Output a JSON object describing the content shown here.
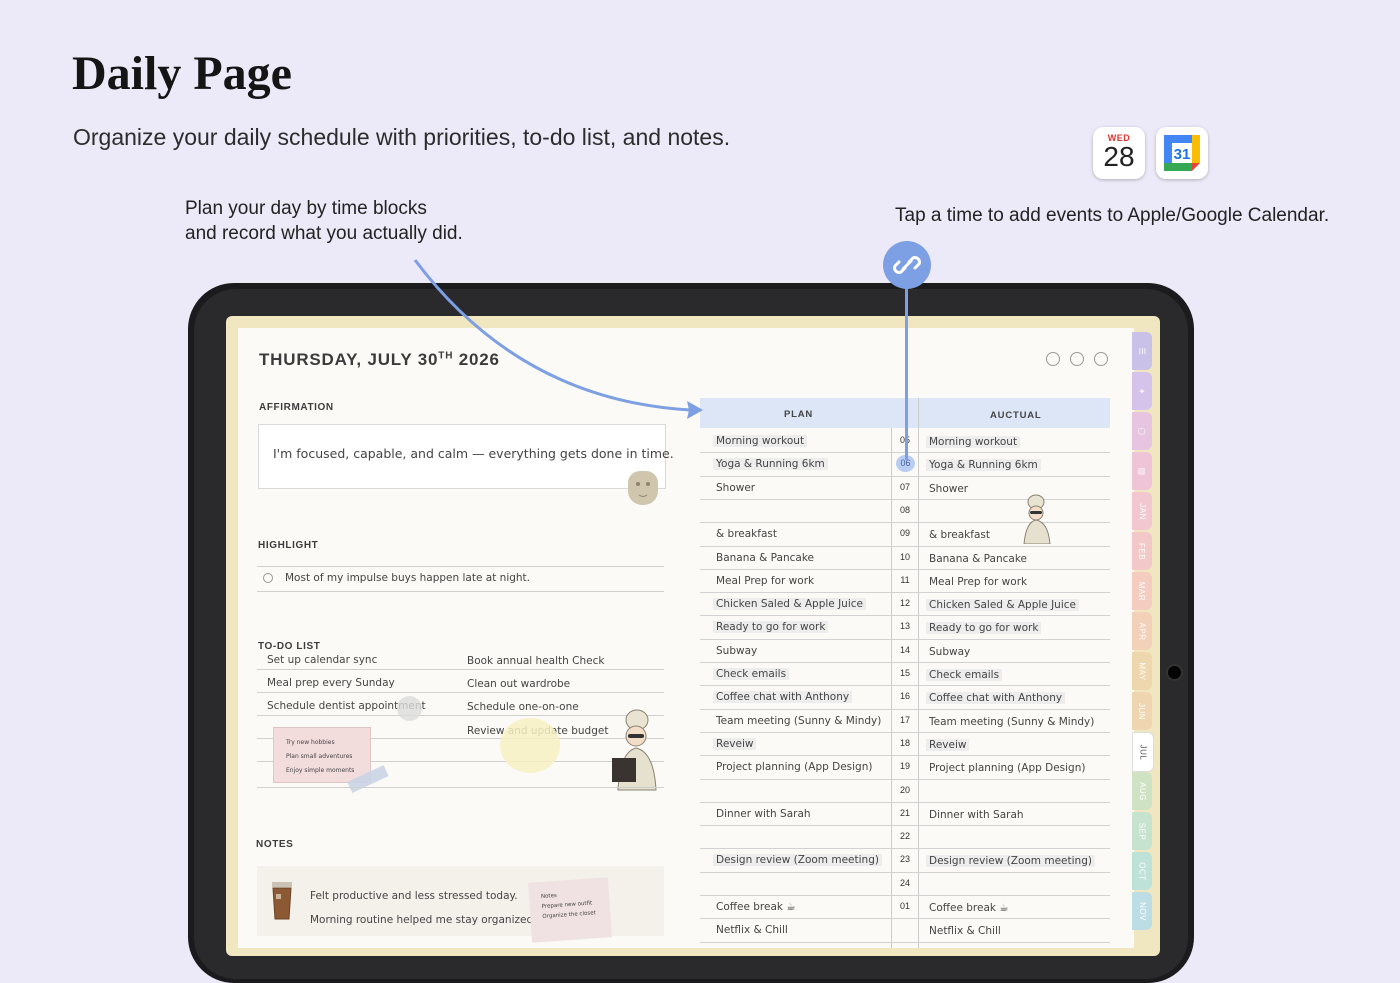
{
  "header": {
    "title": "Daily Page",
    "subtitle": "Organize your daily schedule with priorities, to-do list, and notes.",
    "note_left_1": "Plan your day by time blocks",
    "note_left_2": "and record what you actually did.",
    "note_right": "Tap a time to add events to Apple/Google Calendar."
  },
  "apple_calendar": {
    "weekday": "WED",
    "day": "28"
  },
  "google_calendar": {
    "day": "31"
  },
  "planner": {
    "date_main": "THURSDAY, JULY 30",
    "date_suffix": "TH",
    "date_year": "2026",
    "affirmation_label": "AFFIRMATION",
    "affirmation_text": "I'm focused, capable, and calm — everything gets done in time.",
    "highlight_label": "HIGHLIGHT",
    "highlight_text": "Most of my impulse buys happen late at night.",
    "todo_label": "TO-DO LIST",
    "todo_left": [
      "Set up calendar sync",
      "Meal prep every Sunday",
      "Schedule dentist appointment"
    ],
    "todo_right": [
      "Book annual health Check",
      "Clean out wardrobe",
      "Schedule one-on-one",
      "Review and update budget"
    ],
    "sticky_note": [
      "Try new hobbies",
      "Plan small adventures",
      "Enjoy simple moments"
    ],
    "notes_label": "NOTES",
    "notes_lines": [
      "Felt productive and less stressed today.",
      "Morning routine helped me stay organized."
    ],
    "notes_card_title": "Notes",
    "notes_card_lines": [
      "Prepare new outfit",
      "Organize the closet"
    ]
  },
  "schedule": {
    "plan_label": "PLAN",
    "actual_label": "AUCTUAL",
    "rows": [
      {
        "hour": "05",
        "plan": "Morning workout",
        "actual": "Morning workout",
        "chip": true
      },
      {
        "hour": "06",
        "plan": "Yoga & Running 6km",
        "actual": "Yoga & Running 6km",
        "chip": true,
        "highlight": true
      },
      {
        "hour": "07",
        "plan": "Shower",
        "actual": "Shower",
        "chip": false
      },
      {
        "hour": "08",
        "plan": "",
        "actual": "",
        "chip": false
      },
      {
        "hour": "09",
        "plan": "& breakfast",
        "actual": "& breakfast",
        "chip": false
      },
      {
        "hour": "10",
        "plan": "Banana & Pancake",
        "actual": "Banana & Pancake",
        "chip": false
      },
      {
        "hour": "11",
        "plan": "Meal Prep for work",
        "actual": "Meal Prep for work",
        "chip": false
      },
      {
        "hour": "12",
        "plan": "Chicken Saled & Apple Juice",
        "actual": "Chicken Saled & Apple Juice",
        "chip": true
      },
      {
        "hour": "13",
        "plan": "Ready to go for work",
        "actual": "Ready to go for work",
        "chip": true
      },
      {
        "hour": "14",
        "plan": "Subway",
        "actual": "Subway",
        "chip": false
      },
      {
        "hour": "15",
        "plan": "Check emails",
        "actual": "Check emails",
        "chip": true
      },
      {
        "hour": "16",
        "plan": "Coffee chat with Anthony",
        "actual": "Coffee chat with Anthony",
        "chip": true
      },
      {
        "hour": "17",
        "plan": "Team meeting (Sunny & Mindy)",
        "actual": "Team meeting (Sunny & Mindy)",
        "chip": false
      },
      {
        "hour": "18",
        "plan": "Reveiw",
        "actual": "Reveiw",
        "chip": true
      },
      {
        "hour": "19",
        "plan": "Project planning (App Design)",
        "actual": "Project planning (App Design)",
        "chip": false
      },
      {
        "hour": "20",
        "plan": "",
        "actual": "",
        "chip": false
      },
      {
        "hour": "21",
        "plan": "Dinner with Sarah",
        "actual": "Dinner with Sarah",
        "chip": false
      },
      {
        "hour": "22",
        "plan": "",
        "actual": "",
        "chip": false
      },
      {
        "hour": "23",
        "plan": "Design review (Zoom meeting)",
        "actual": "Design review (Zoom meeting)",
        "chip": true
      },
      {
        "hour": "24",
        "plan": "",
        "actual": "",
        "chip": false
      },
      {
        "hour": "01",
        "plan": "Coffee break ☕",
        "actual": "Coffee break ☕",
        "chip": false
      },
      {
        "hour": "",
        "plan": "Netflix & Chill",
        "actual": "Netflix & Chill",
        "chip": false
      }
    ]
  },
  "tabs": [
    {
      "label": "☰",
      "color": "#c9c1e8"
    },
    {
      "label": "✦",
      "color": "#d6c3ec"
    },
    {
      "label": "▢",
      "color": "#e7c5e0"
    },
    {
      "label": "▤",
      "color": "#eec4d6"
    },
    {
      "label": "JAN",
      "color": "#f2c7cf"
    },
    {
      "label": "FEB",
      "color": "#f3c8c8"
    },
    {
      "label": "MAR",
      "color": "#f5ccc0"
    },
    {
      "label": "APR",
      "color": "#f3d0b8"
    },
    {
      "label": "MAY",
      "color": "#efd7ad"
    },
    {
      "label": "JUN",
      "color": "#f0d6b0"
    },
    {
      "label": "JUL",
      "color": "#ffffff"
    },
    {
      "label": "AUG",
      "color": "#cfe3c4"
    },
    {
      "label": "SEP",
      "color": "#c6e3cf"
    },
    {
      "label": "OCT",
      "color": "#bfe2d8"
    },
    {
      "label": "NOV",
      "color": "#bcdde3"
    }
  ]
}
